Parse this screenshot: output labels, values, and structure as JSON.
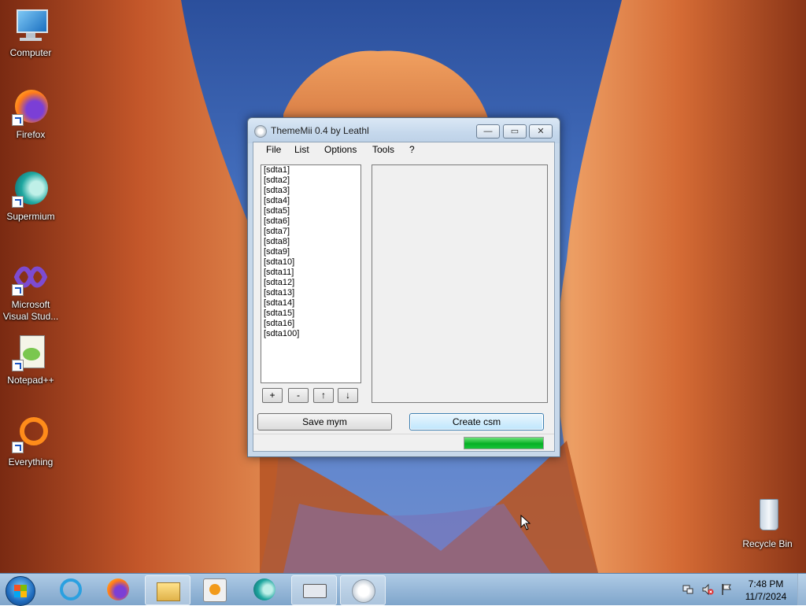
{
  "desktop": {
    "icons": [
      {
        "label": "Computer",
        "icon": "computer-icon"
      },
      {
        "label": "Firefox",
        "icon": "firefox-icon"
      },
      {
        "label": "Supermium",
        "icon": "supermium-icon"
      },
      {
        "label": "Microsoft Visual Stud...",
        "icon": "visual-studio-icon"
      },
      {
        "label": "Notepad++",
        "icon": "notepadpp-icon"
      },
      {
        "label": "Everything",
        "icon": "everything-icon"
      },
      {
        "label": "Recycle Bin",
        "icon": "recycle-bin-icon"
      }
    ]
  },
  "window": {
    "title": "ThemeMii 0.4 by Leathl",
    "controls": {
      "minimize": "—",
      "maximize": "▭",
      "close": "✕"
    },
    "menu": [
      "File",
      "List",
      "Options",
      "Tools",
      "?"
    ],
    "list_items": [
      "[sdta1]",
      "[sdta2]",
      "[sdta3]",
      "[sdta4]",
      "[sdta5]",
      "[sdta6]",
      "[sdta7]",
      "[sdta8]",
      "[sdta9]",
      "[sdta10]",
      "[sdta11]",
      "[sdta12]",
      "[sdta13]",
      "[sdta14]",
      "[sdta15]",
      "[sdta16]",
      "[sdta100]"
    ],
    "list_buttons": {
      "add": "+",
      "remove": "-",
      "up": "↑",
      "down": "↓"
    },
    "save_button": "Save mym",
    "create_button": "Create csm",
    "progress": 1.0,
    "progress_color": "#06b025"
  },
  "taskbar": {
    "items": [
      "internet-explorer-icon",
      "firefox-icon",
      "file-explorer-icon",
      "media-player-icon",
      "supermium-icon",
      "keyboard-settings-icon",
      "thememii-icon"
    ],
    "clock_time": "7:48 PM",
    "clock_date": "11/7/2024"
  }
}
